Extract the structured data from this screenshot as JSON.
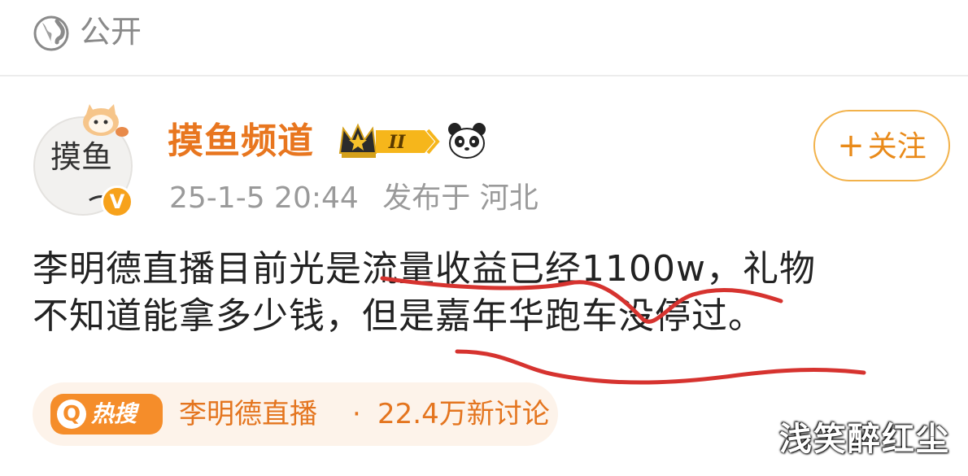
{
  "header": {
    "visibility_label": "公开",
    "visibility_icon": "globe-icon"
  },
  "author": {
    "name": "摸鱼频道",
    "vip_level": "II",
    "verified_label": "V",
    "follow_label": "关注",
    "avatar_text": "摸鱼",
    "timestamp": "25-1-5 20:44",
    "published_at": "发布于 河北"
  },
  "post": {
    "line1": "李明德直播目前光是流量收益已经1100w，礼物",
    "line2": "不知道能拿多少钱，但是嘉年华跑车没停过。"
  },
  "hot_topic": {
    "badge_icon": "Q",
    "badge_label": "热搜",
    "title": "李明德直播",
    "separator": "·",
    "count": "22.4万新讨论"
  },
  "watermark": "浅笑醉红尘",
  "colors": {
    "accent": "#e8761f",
    "follow_border": "#f2b24b",
    "annotation_red": "#d6332f",
    "hot_bg": "#fdf3ea"
  }
}
